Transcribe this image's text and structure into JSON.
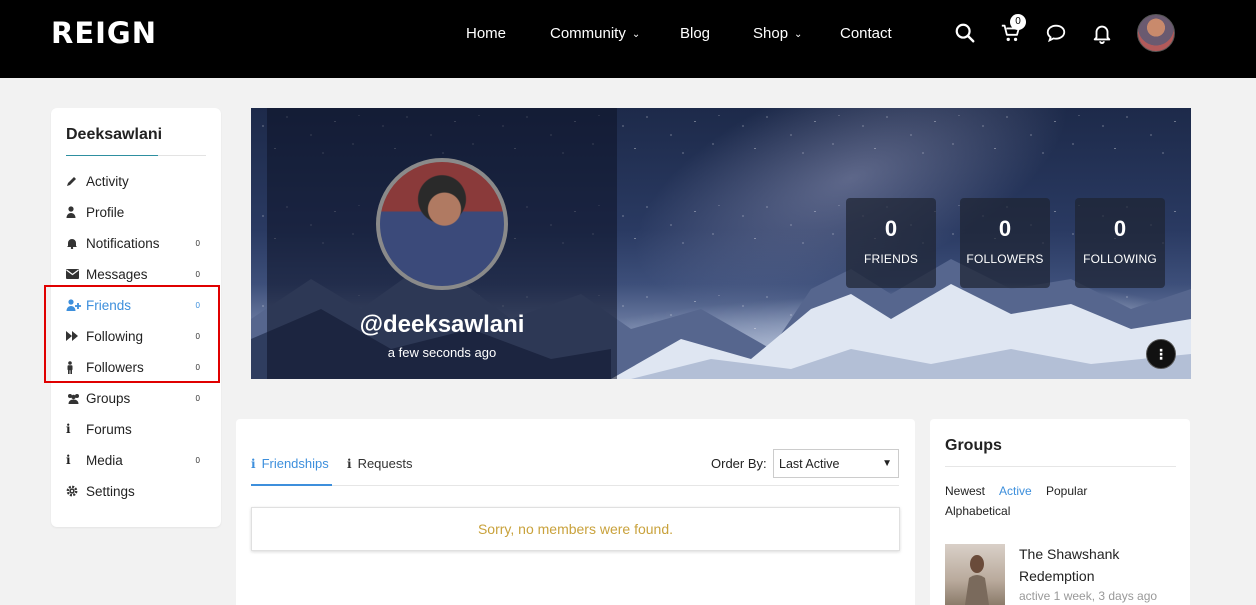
{
  "brand": {
    "logo": "REIGN"
  },
  "nav": {
    "items": [
      {
        "label": "Home",
        "has_dropdown": false
      },
      {
        "label": "Community",
        "has_dropdown": true
      },
      {
        "label": "Blog",
        "has_dropdown": false
      },
      {
        "label": "Shop",
        "has_dropdown": true
      },
      {
        "label": "Contact",
        "has_dropdown": false
      }
    ],
    "cart_count": "0",
    "icons": [
      "search-icon",
      "cart-icon",
      "chat-icon",
      "bell-icon",
      "avatar"
    ]
  },
  "sidebar": {
    "username": "Deeksawlani",
    "items": [
      {
        "label": "Activity",
        "icon": "pencil-icon",
        "count": ""
      },
      {
        "label": "Profile",
        "icon": "user-icon",
        "count": ""
      },
      {
        "label": "Notifications",
        "icon": "bell-icon",
        "count": "0"
      },
      {
        "label": "Messages",
        "icon": "envelope-icon",
        "count": "0"
      },
      {
        "label": "Friends",
        "icon": "user-plus-icon",
        "count": "0",
        "active": true
      },
      {
        "label": "Following",
        "icon": "fast-forward-icon",
        "count": "0"
      },
      {
        "label": "Followers",
        "icon": "person-icon",
        "count": "0"
      },
      {
        "label": "Groups",
        "icon": "users-icon",
        "count": "0"
      },
      {
        "label": "Forums",
        "icon": "info-icon",
        "count": ""
      },
      {
        "label": "Media",
        "icon": "info-icon",
        "count": "0"
      },
      {
        "label": "Settings",
        "icon": "gear-icon",
        "count": ""
      }
    ]
  },
  "profile": {
    "handle": "@deeksawlani",
    "last_active": "a few seconds ago",
    "stats": [
      {
        "value": "0",
        "label": "FRIENDS"
      },
      {
        "value": "0",
        "label": "FOLLOWERS"
      },
      {
        "value": "0",
        "label": "FOLLOWING"
      }
    ],
    "more_label": "⋮"
  },
  "friends_panel": {
    "tabs": [
      {
        "label": "Friendships",
        "active": true
      },
      {
        "label": "Requests",
        "active": false
      }
    ],
    "order_by_label": "Order By:",
    "order_by_value": "Last Active",
    "empty_message": "Sorry, no members were found."
  },
  "groups_widget": {
    "title": "Groups",
    "filters": [
      {
        "label": "Newest",
        "active": false
      },
      {
        "label": "Active",
        "active": true
      },
      {
        "label": "Popular",
        "active": false
      },
      {
        "label": "Alphabetical",
        "active": false
      }
    ],
    "items": [
      {
        "name": "The Shawshank Redemption",
        "meta": "active 1 week, 3 days ago"
      }
    ]
  },
  "colors": {
    "accent": "#3d8fdc",
    "header_bg": "#000000",
    "notice_text": "#c9a23c",
    "highlight": "#e00000"
  }
}
